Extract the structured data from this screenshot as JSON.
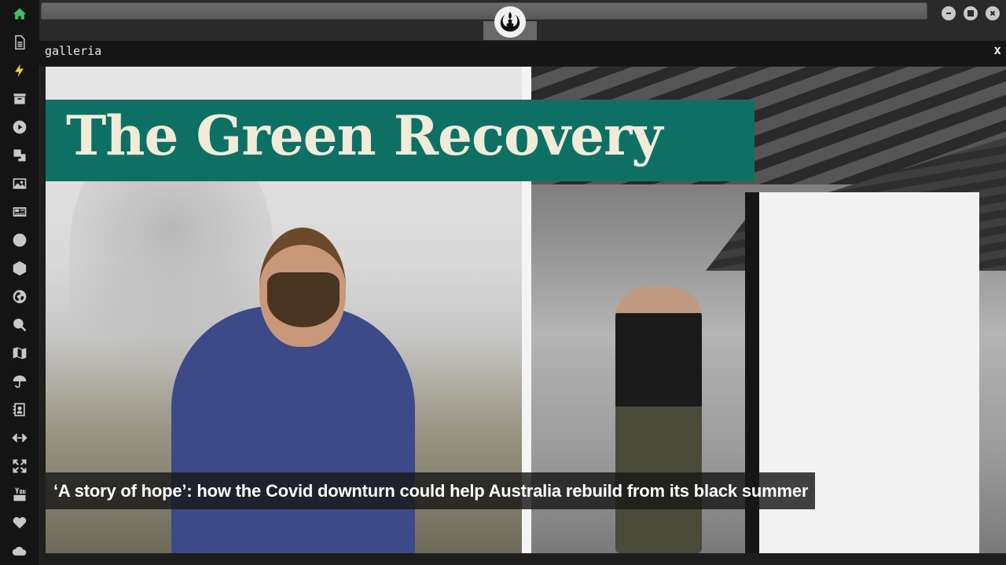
{
  "sidebar": {
    "items": [
      {
        "icon": "home-icon",
        "active": true
      },
      {
        "icon": "document-icon"
      },
      {
        "icon": "bolt-icon"
      },
      {
        "icon": "archive-icon"
      },
      {
        "icon": "play-icon"
      },
      {
        "icon": "translate-icon"
      },
      {
        "icon": "image-icon"
      },
      {
        "icon": "newspaper-icon"
      },
      {
        "icon": "galactic-empire-icon"
      },
      {
        "icon": "hexagon-icon"
      },
      {
        "icon": "globe-icon"
      },
      {
        "icon": "search-icon"
      },
      {
        "icon": "map-icon"
      },
      {
        "icon": "umbrella-icon"
      },
      {
        "icon": "contact-book-icon"
      },
      {
        "icon": "code-icon"
      },
      {
        "icon": "expand-icon"
      },
      {
        "icon": "youtube-icon"
      },
      {
        "icon": "heart-icon"
      },
      {
        "icon": "cloud-icon"
      }
    ],
    "colors": {
      "active": "#3fbf5f",
      "bolt": "#f0d040",
      "default": "#c8c8c8"
    }
  },
  "topbar": {
    "logo_icon": "rebel-alliance-icon",
    "window_buttons": [
      "minimize-icon",
      "maximize-icon",
      "close-icon"
    ]
  },
  "panel": {
    "title": "galleria",
    "close_label": "x"
  },
  "gallery": {
    "banner_text": "The Green Recovery",
    "caption": "‘A story of hope’: how the Covid downturn could help Australia rebuild from its black summer",
    "banner_color": "#0e7065"
  }
}
